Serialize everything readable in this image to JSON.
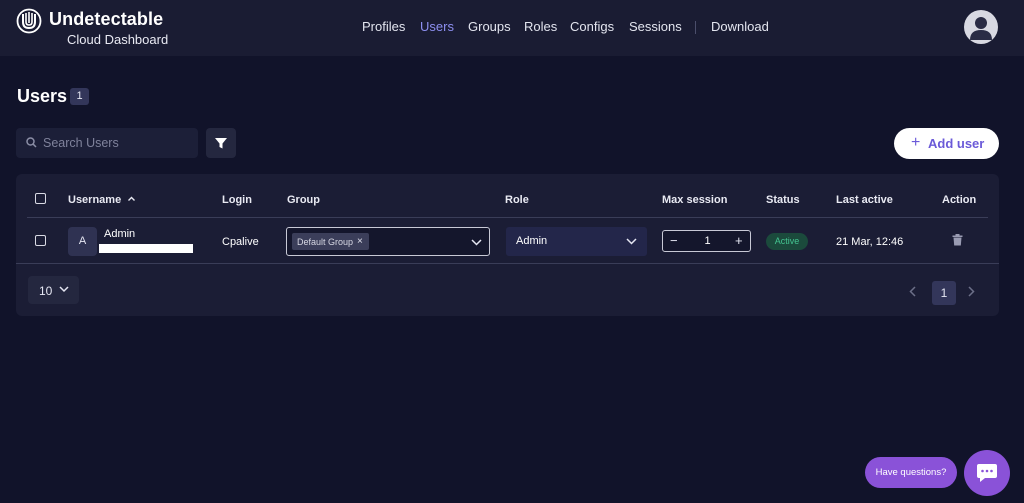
{
  "brand": {
    "title": "Undetectable",
    "subtitle": "Cloud Dashboard"
  },
  "nav": {
    "items": [
      "Profiles",
      "Users",
      "Groups",
      "Roles",
      "Configs",
      "Sessions",
      "Download"
    ],
    "active": "Users"
  },
  "page": {
    "title": "Users",
    "count": "1"
  },
  "toolbar": {
    "search_placeholder": "Search Users",
    "add_user_label": "Add user",
    "add_user_icon": "plus-icon",
    "filter_icon": "filter-icon"
  },
  "table": {
    "columns": [
      "Username",
      "Login",
      "Group",
      "Role",
      "Max session",
      "Status",
      "Last active",
      "Action"
    ],
    "sort_indicator": "^",
    "rows": [
      {
        "avatar_initial": "A",
        "username": "Admin",
        "login": "Cpalive",
        "group_chip": "Default Group",
        "group_chip_remove": "×",
        "role": "Admin",
        "max_session": "1",
        "status": "Active",
        "last_active": "21 Mar, 12:46",
        "action_icon": "trash-icon"
      }
    ]
  },
  "pagination": {
    "per_page": "10",
    "current_page": "1"
  },
  "stepper": {
    "minus": "−",
    "plus": "+"
  },
  "help": {
    "label": "Have questions?",
    "icon": "chat-icon"
  },
  "colors": {
    "background": "#11132a",
    "topbar": "#1a1c33",
    "panel": "#1b1d35",
    "accent": "#8d8ff0",
    "button_text": "#6b5ad8",
    "status_active": "#44c490",
    "chat": "#8a52d8"
  }
}
